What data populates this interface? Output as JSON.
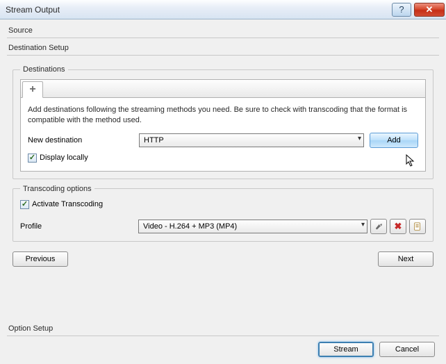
{
  "window": {
    "title": "Stream Output"
  },
  "sections": {
    "source": "Source",
    "destination_setup": "Destination Setup",
    "option_setup": "Option Setup"
  },
  "destinations": {
    "legend": "Destinations",
    "instructions": "Add destinations following the streaming methods you need. Be sure to check with transcoding that the format is compatible with the method used.",
    "new_destination_label": "New destination",
    "method_selected": "HTTP",
    "add_button": "Add",
    "display_locally_label": "Display locally",
    "display_locally_checked": true
  },
  "transcoding": {
    "legend": "Transcoding options",
    "activate_label": "Activate Transcoding",
    "activate_checked": true,
    "profile_label": "Profile",
    "profile_selected": "Video - H.264 + MP3 (MP4)"
  },
  "nav": {
    "previous": "Previous",
    "next": "Next"
  },
  "footer": {
    "stream": "Stream",
    "cancel": "Cancel"
  }
}
